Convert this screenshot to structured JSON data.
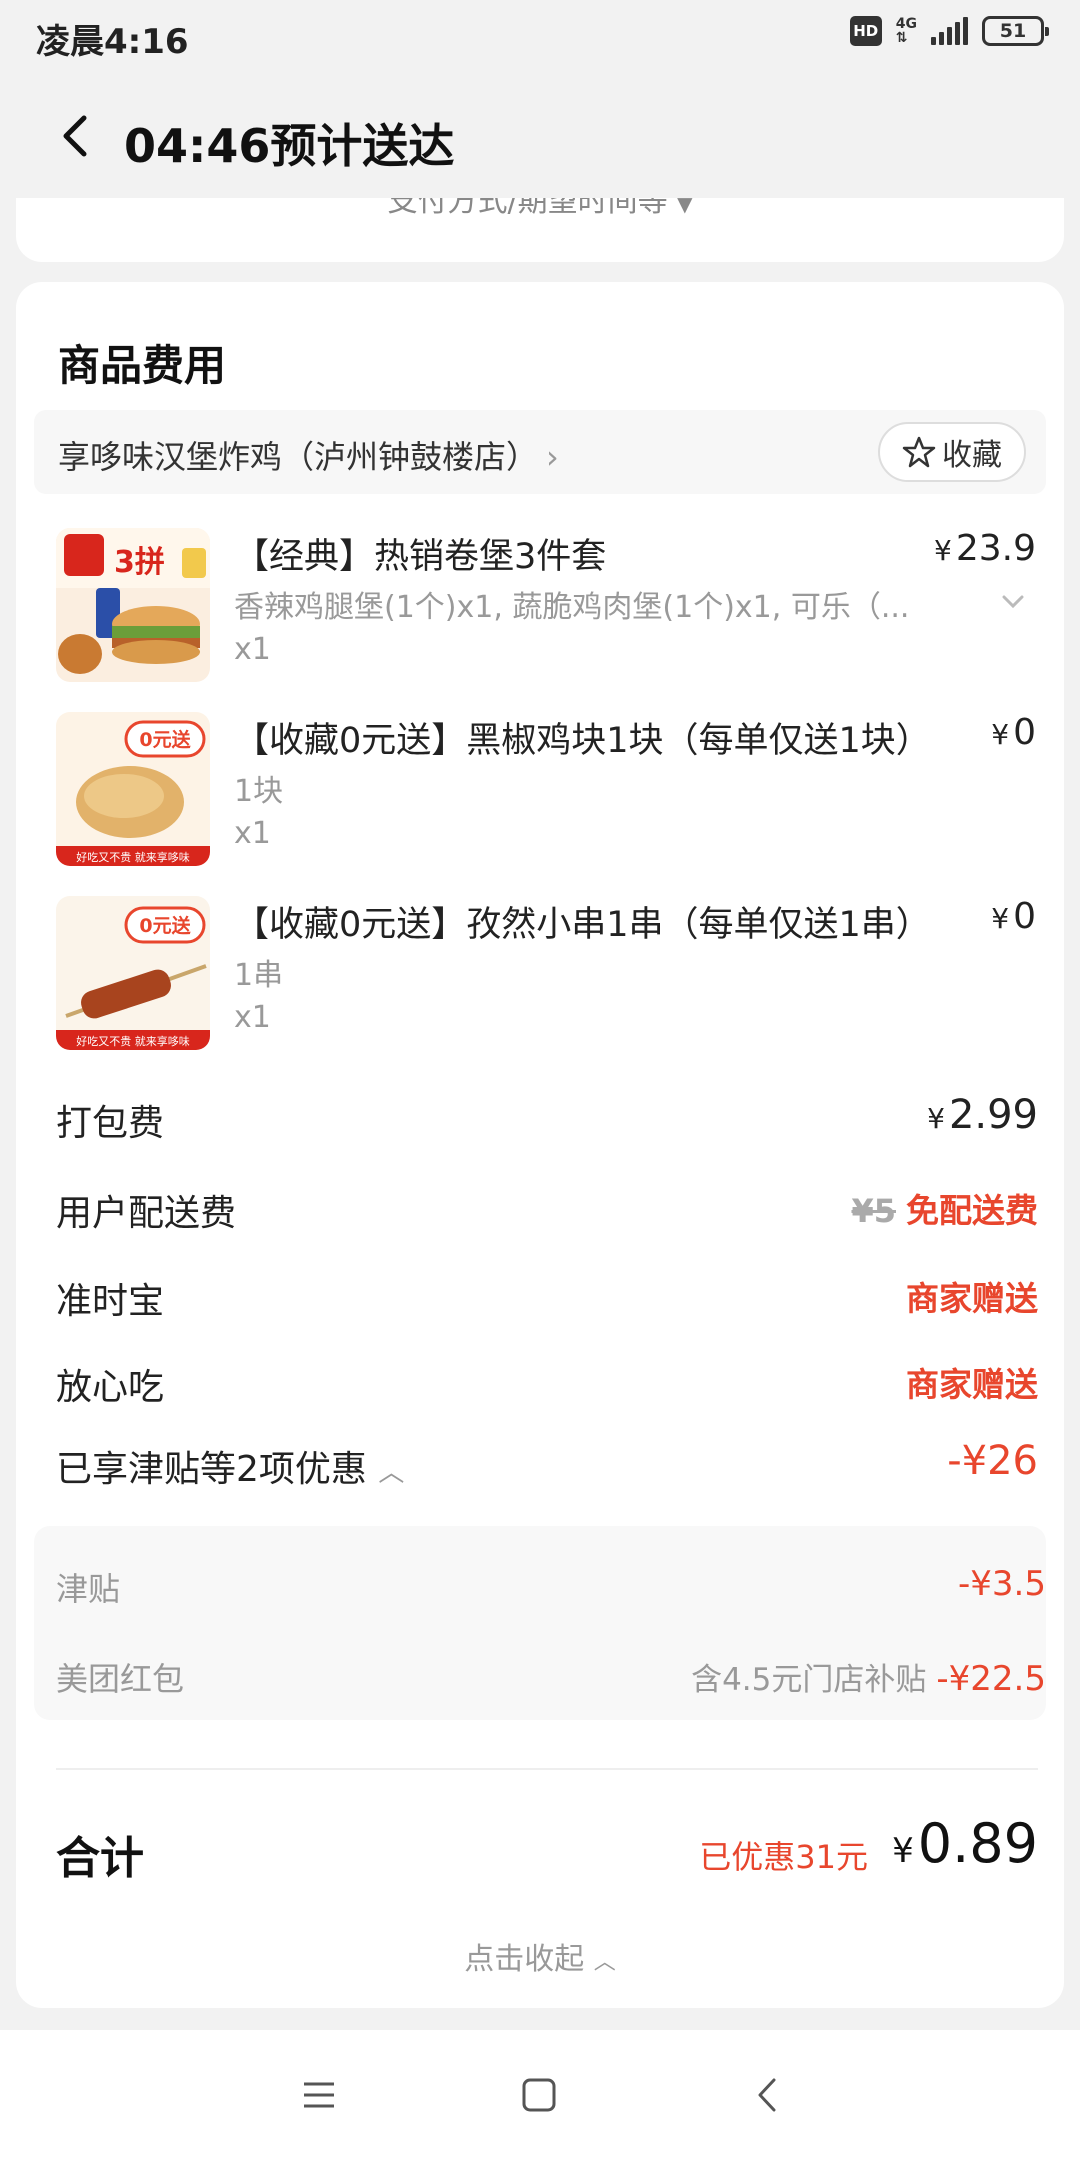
{
  "status": {
    "time": "凌晨4:16",
    "hd": "HD",
    "network": "4G",
    "battery": "51"
  },
  "header": {
    "title": "04:46预计送达"
  },
  "prev_card": {
    "text": "支付方式/期望时间等"
  },
  "fees_card": {
    "title": "商品费用",
    "shop": {
      "name": "享哆味汉堡炸鸡（泸州钟鼓楼店）",
      "fav_label": "收藏"
    },
    "items": [
      {
        "name": "【经典】热销卷堡3件套",
        "spec": "香辣鸡腿堡(1个)x1, 蔬脆鸡肉堡(1个)x1, 可乐（...",
        "qty": "x1",
        "price_symbol": "¥",
        "price": "23.9",
        "thumb_badge": "3拼"
      },
      {
        "name": "【收藏0元送】黑椒鸡块1块（每单仅送1块）",
        "spec": "1块",
        "qty": "x1",
        "price_symbol": "¥",
        "price": "0",
        "thumb_badge": "0元送",
        "thumb_footer": "好吃又不贵 就来享哆味"
      },
      {
        "name": "【收藏0元送】孜然小串1串（每单仅送1串）",
        "spec": "1串",
        "qty": "x1",
        "price_symbol": "¥",
        "price": "0",
        "thumb_badge": "0元送",
        "thumb_footer": "好吃又不贵 就来享哆味"
      }
    ],
    "packing": {
      "label": "打包费",
      "symbol": "¥",
      "value": "2.99"
    },
    "delivery": {
      "label": "用户配送费",
      "original": "¥5",
      "value": "免配送费"
    },
    "ontime": {
      "label": "准时宝",
      "value": "商家赠送"
    },
    "safe": {
      "label": "放心吃",
      "value": "商家赠送"
    },
    "discount": {
      "label": "已享津贴等2项优惠",
      "value": "-¥26"
    },
    "discount_details": [
      {
        "label": "津贴",
        "note": "",
        "value": "-¥3.5"
      },
      {
        "label": "美团红包",
        "note": "含4.5元门店补贴",
        "value": "-¥22.5"
      }
    ],
    "total": {
      "label": "合计",
      "saved": "已优惠31元",
      "symbol": "¥",
      "value": "0.89"
    },
    "collapse_label": "点击收起"
  },
  "colors": {
    "accent": "#e8462d",
    "background": "#f2f2f2",
    "card": "#ffffff"
  }
}
